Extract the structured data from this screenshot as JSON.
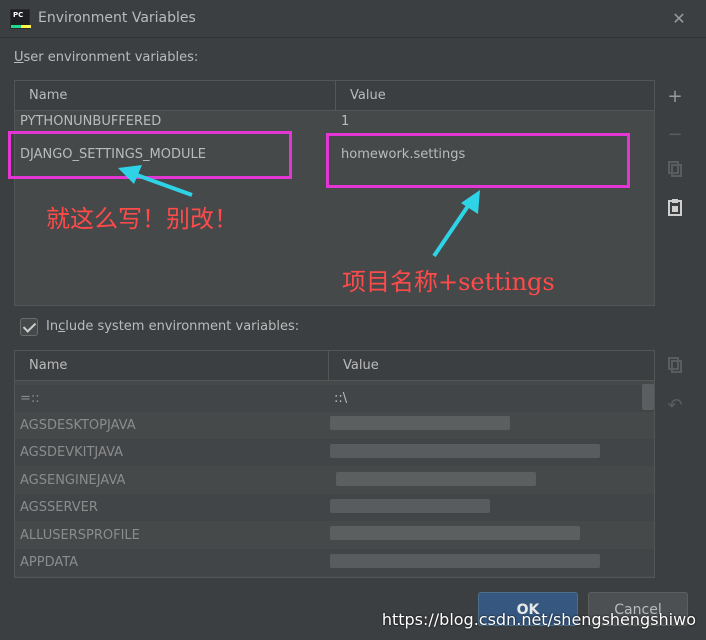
{
  "window": {
    "title": "Environment Variables"
  },
  "user_section": {
    "label_u": "U",
    "label_rest": "ser environment variables:"
  },
  "user_table": {
    "columns": [
      "Name",
      "Value"
    ],
    "rows": [
      {
        "name": "PYTHONUNBUFFERED",
        "value": "1"
      },
      {
        "name": "DJANGO_SETTINGS_MODULE",
        "value": "homework.settings"
      }
    ]
  },
  "include_system": {
    "label_pre": "In",
    "label_u": "c",
    "label_rest": "lude system environment variables:",
    "checked": true
  },
  "system_table": {
    "columns": [
      "Name",
      "Value"
    ],
    "rows": [
      {
        "name": "=::",
        "value": "::\\"
      },
      {
        "name": "AGSDESKTOPJAVA",
        "value": ""
      },
      {
        "name": "AGSDEVKITJAVA",
        "value": ""
      },
      {
        "name": "AGSENGINEJAVA",
        "value": ""
      },
      {
        "name": "AGSSERVER",
        "value": ""
      },
      {
        "name": "ALLUSERSPROFILE",
        "value": ""
      },
      {
        "name": "APPDATA",
        "value": ""
      }
    ]
  },
  "buttons": {
    "ok": "OK",
    "cancel": "Cancel"
  },
  "annotations": {
    "keep_note": "就这么写！别改！",
    "project_note": "项目名称+settings",
    "watermark": "https://blog.csdn.net/shengshengshiwo"
  },
  "colors": {
    "highlight": "#e436d4",
    "arrow": "#2ed3e6",
    "note": "#ff4a4a",
    "ok_button": "#365880"
  }
}
